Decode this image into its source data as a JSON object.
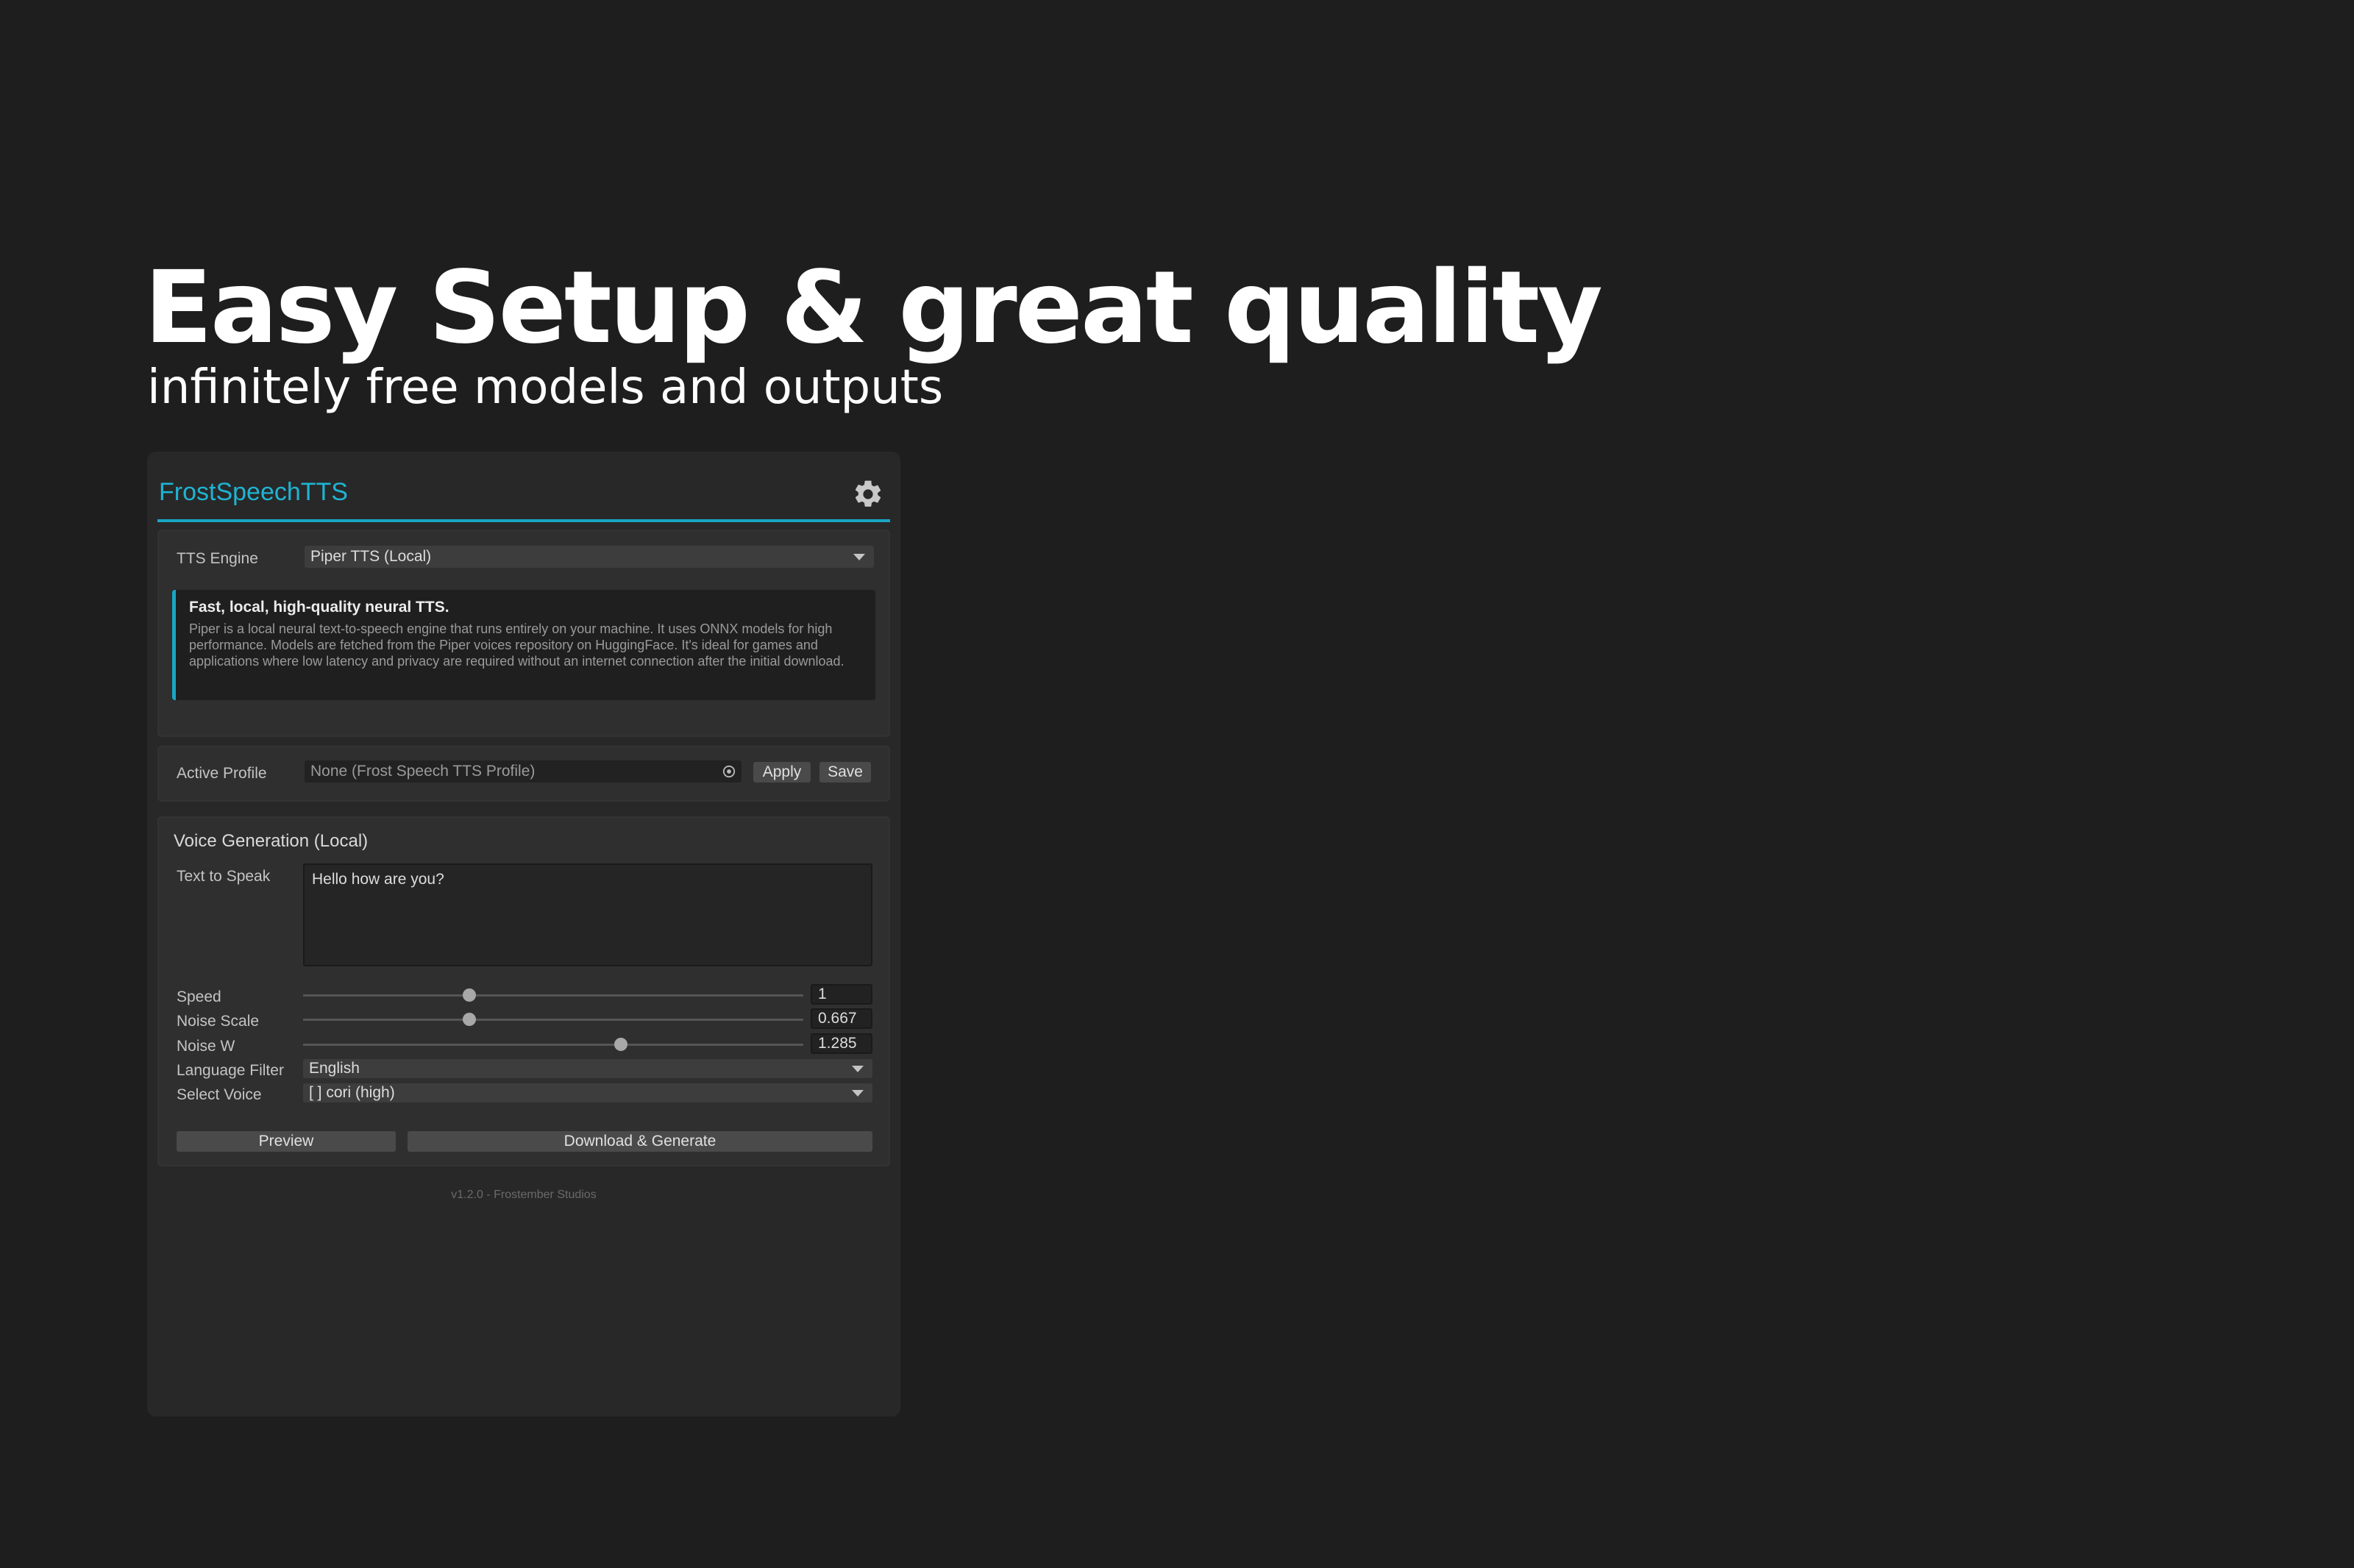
{
  "hero": {
    "title": "Easy Setup & great quality",
    "subtitle": "infinitely free models and outputs"
  },
  "app": {
    "title": "FrostSpeechTTS",
    "settings_icon": "gear-icon",
    "accent_color": "#1aa6c4"
  },
  "engine": {
    "label": "TTS Engine",
    "selected": "Piper TTS (Local)",
    "info_title": "Fast, local, high-quality neural TTS.",
    "info_body": "Piper is a local neural text-to-speech engine that runs entirely on your machine. It uses ONNX models for high performance. Models are fetched from the Piper voices repository on HuggingFace. It's ideal for games and applications where low latency and privacy are required without an internet connection after the initial download."
  },
  "profile": {
    "label": "Active Profile",
    "value": "None (Frost Speech TTS Profile)",
    "apply_label": "Apply",
    "save_label": "Save"
  },
  "voice": {
    "section_title": "Voice Generation (Local)",
    "text_label": "Text to Speak",
    "text_value": "Hello how are you?",
    "speed": {
      "label": "Speed",
      "value": "1",
      "fraction": 0.333
    },
    "noise_scale": {
      "label": "Noise Scale",
      "value": "0.667",
      "fraction": 0.333
    },
    "noise_w": {
      "label": "Noise W",
      "value": "1.285",
      "fraction": 0.635
    },
    "language": {
      "label": "Language Filter",
      "selected": "English"
    },
    "select_voice": {
      "label": "Select Voice",
      "selected": "[ ] cori (high)"
    },
    "preview_label": "Preview",
    "generate_label": "Download & Generate"
  },
  "footer": "v1.2.0 - Frostember Studios"
}
